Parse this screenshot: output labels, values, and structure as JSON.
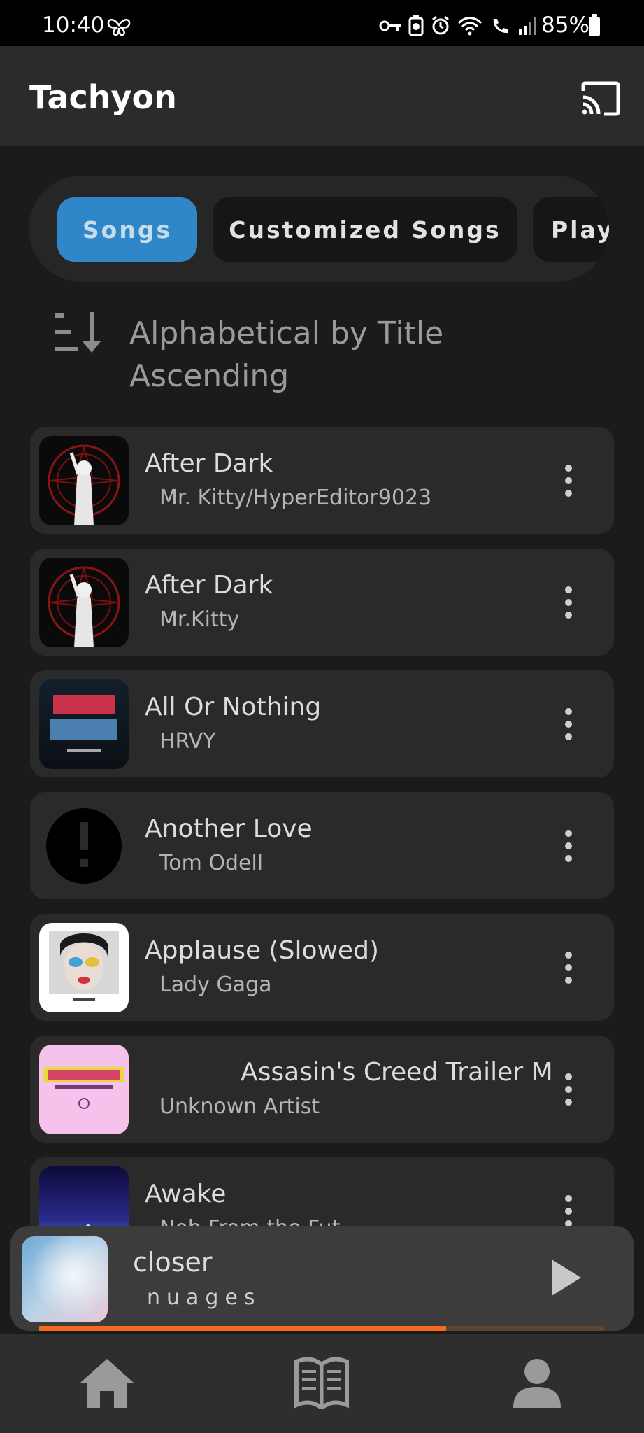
{
  "status_bar": {
    "time": "10:40",
    "battery_percent": "85%"
  },
  "app_bar": {
    "title": "Tachyon",
    "cast_icon": "cast-icon"
  },
  "tabs": [
    {
      "label": "Songs",
      "selected": true
    },
    {
      "label": "Customized Songs",
      "selected": false
    },
    {
      "label": "Play",
      "selected": false
    }
  ],
  "sort": {
    "line1": "Alphabetical by Title",
    "line2": "Ascending",
    "icon": "sort-descending-icon"
  },
  "songs": [
    {
      "title": "After Dark",
      "artist": "Mr. Kitty/HyperEditor9023",
      "art": "red-circle-white-figure"
    },
    {
      "title": "After Dark",
      "artist": "Mr.Kitty",
      "art": "red-circle-white-figure"
    },
    {
      "title": "All Or Nothing",
      "artist": "HRVY",
      "art": "all-or-nothing-cover"
    },
    {
      "title": "Another Love",
      "artist": "Tom Odell",
      "art": "missing-art-exclamation-icon"
    },
    {
      "title": "Applause (Slowed)",
      "artist": "Lady Gaga",
      "art": "painted-face-cover"
    },
    {
      "title": "Assasin's Creed Trailer M",
      "artist": "Unknown Artist",
      "art": "pink-cover"
    },
    {
      "title": "Awake",
      "artist": "Nob From the Fut",
      "art": "concert-lights-cover"
    }
  ],
  "now_playing": {
    "title": "closer",
    "artist": "nuages",
    "progress": 0.72,
    "accent": "#f36b1c"
  },
  "nav": [
    {
      "icon": "home-icon"
    },
    {
      "icon": "library-book-icon"
    },
    {
      "icon": "profile-icon"
    }
  ],
  "colors": {
    "accent_blue": "#2f86c8",
    "background": "#1b1b1b",
    "card": "#2a2a2a"
  }
}
